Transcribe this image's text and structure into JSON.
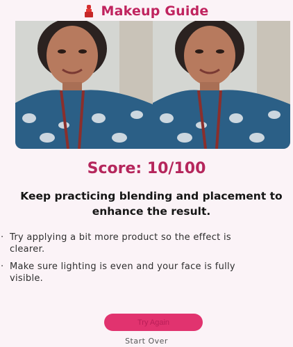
{
  "header": {
    "icon": "lipstick-icon",
    "title": "Makeup Guide"
  },
  "photos": {
    "before_alt": "before-photo",
    "after_alt": "after-photo"
  },
  "result": {
    "score": "Score: 10/100",
    "feedback_line1": "Keep practicing blending and placement to",
    "feedback_line2": "enhance the result."
  },
  "tips": [
    {
      "line1": "Try applying a bit more product so the effect is",
      "line2": "clearer."
    },
    {
      "line1": "Make sure lighting is even and your face is fully",
      "line2": "visible."
    }
  ],
  "actions": {
    "try_again_label": "Try Again",
    "start_over_label": "Start Over"
  },
  "colors": {
    "accent": "#c0245f",
    "button": "#e1336f",
    "background": "#fbf3f7"
  }
}
